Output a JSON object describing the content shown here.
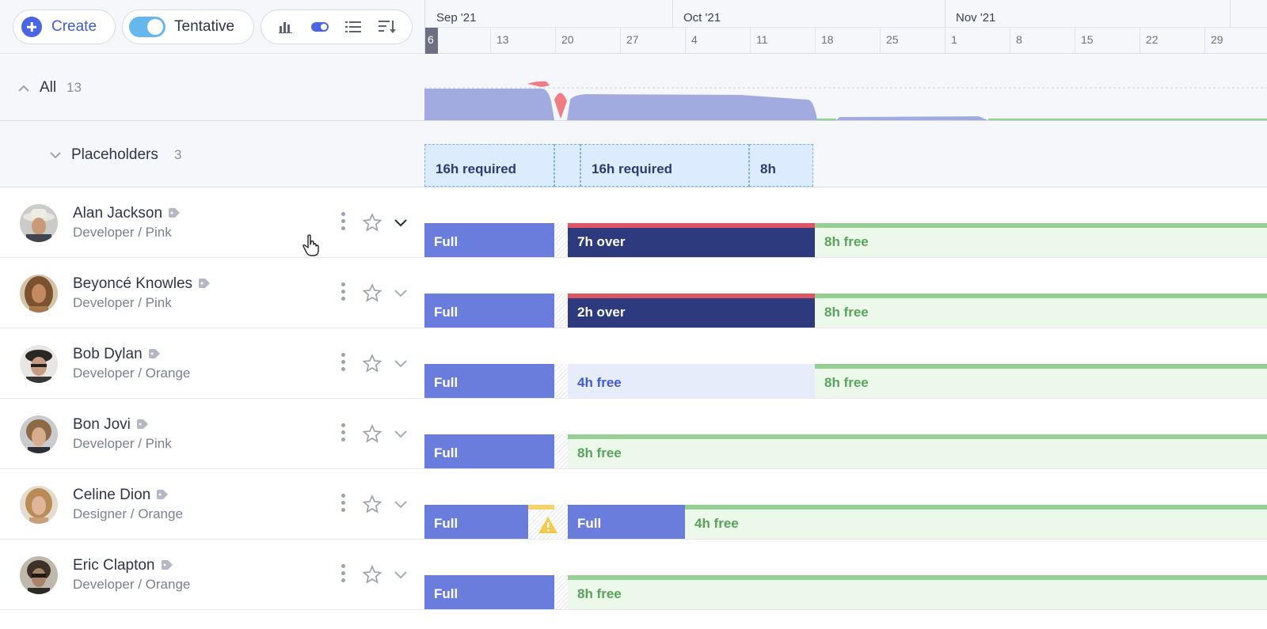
{
  "toolbar": {
    "create_label": "Create",
    "tentative_label": "Tentative",
    "tentative_on": true,
    "icons": [
      "bar-chart-icon",
      "toggle-icon",
      "list-icon",
      "sort-icon"
    ]
  },
  "timeline": {
    "months": [
      "Sep '21",
      "Oct '21",
      "Nov '21"
    ],
    "weeks": [
      "6",
      "13",
      "20",
      "27",
      "4",
      "11",
      "18",
      "25",
      "1",
      "8",
      "15",
      "22",
      "29"
    ],
    "current_week": "6"
  },
  "all_group": {
    "label": "All",
    "count": "13"
  },
  "placeholders_group": {
    "label": "Placeholders",
    "count": "3",
    "blocks": [
      "16h required",
      "",
      "16h required",
      "8h"
    ]
  },
  "people": [
    {
      "name": "Alan Jackson",
      "role": "Developer / Pink",
      "bars": [
        "Full",
        "7h over",
        "8h free"
      ]
    },
    {
      "name": "Beyoncé Knowles",
      "role": "Developer / Pink",
      "bars": [
        "Full",
        "2h over",
        "8h free"
      ]
    },
    {
      "name": "Bob Dylan",
      "role": "Developer / Orange",
      "bars": [
        "Full",
        "4h free",
        "8h free"
      ]
    },
    {
      "name": "Bon Jovi",
      "role": "Developer / Pink",
      "bars": [
        "Full",
        "8h free"
      ]
    },
    {
      "name": "Celine Dion",
      "role": "Designer / Orange",
      "bars": [
        "Full",
        "Full",
        "4h free"
      ]
    },
    {
      "name": "Eric Clapton",
      "role": "Developer / Orange",
      "bars": [
        "Full",
        "8h free"
      ]
    }
  ],
  "colors": {
    "accent": "#4b66e2",
    "full": "#6b7ddc",
    "over": "#2e3a7e",
    "overline": "#e05565",
    "free": "#ebf8ea",
    "freeline": "#95cf93",
    "warning": "#f6d36a"
  }
}
